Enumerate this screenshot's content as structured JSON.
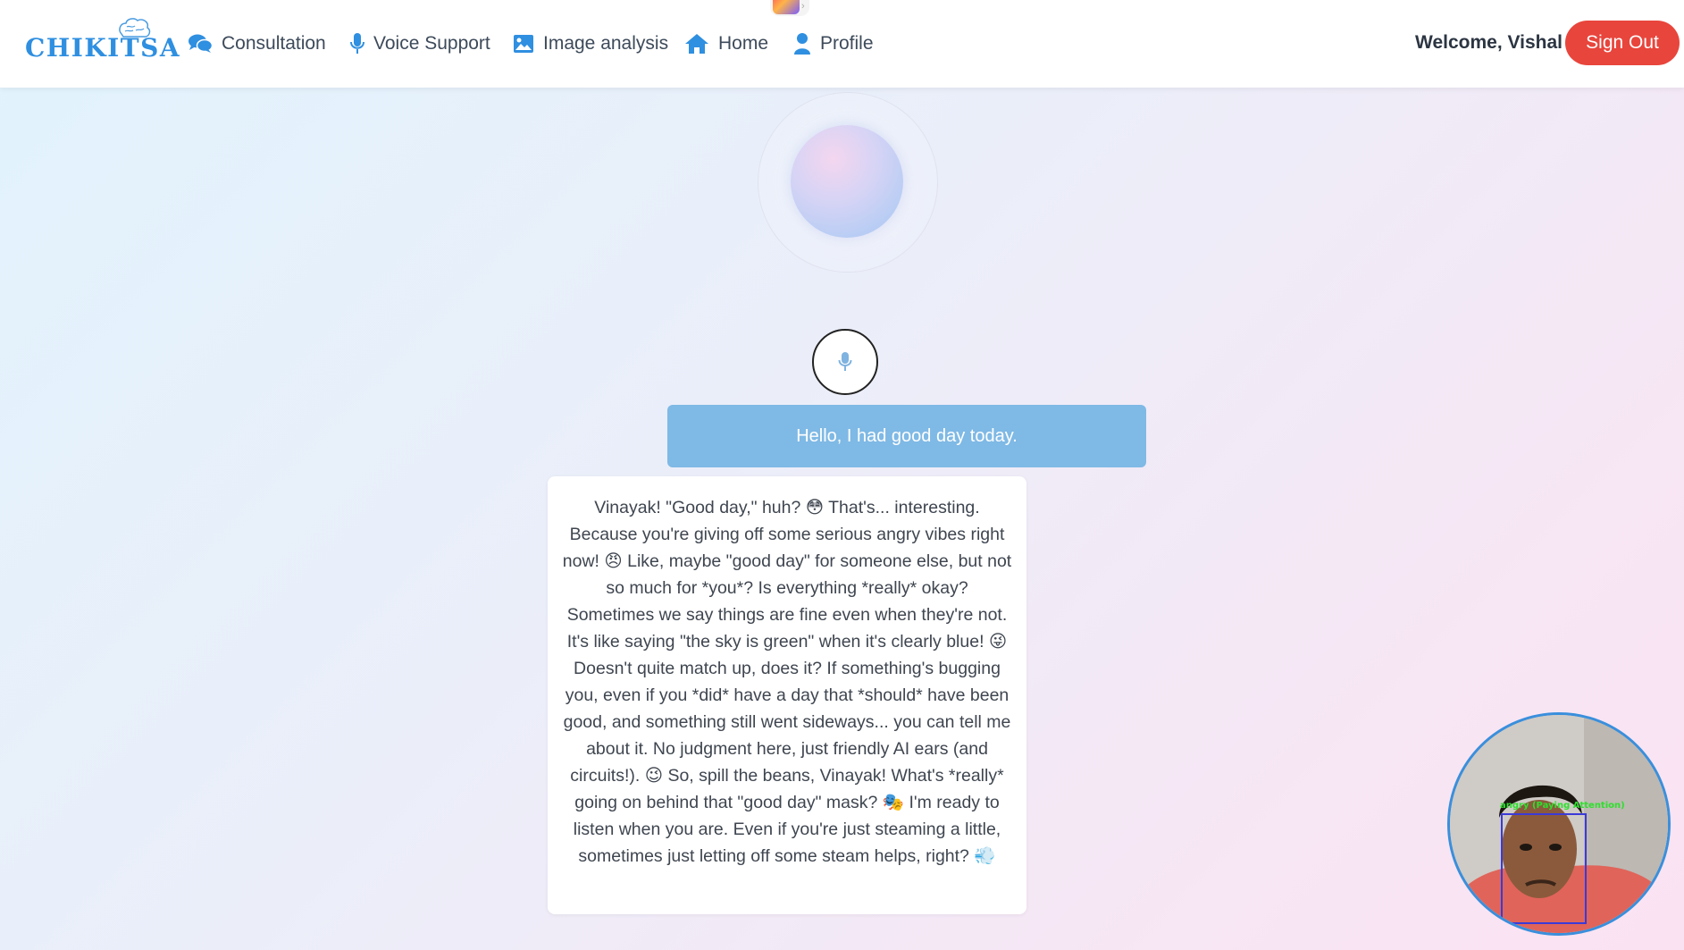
{
  "header": {
    "logo_text": "CHIKITSA",
    "nav": [
      {
        "label": "Consultation",
        "icon": "chat-icon"
      },
      {
        "label": "Voice Support",
        "icon": "microphone-icon"
      },
      {
        "label": "Image analysis",
        "icon": "image-icon"
      },
      {
        "label": "Home",
        "icon": "home-icon"
      },
      {
        "label": "Profile",
        "icon": "user-icon"
      }
    ],
    "welcome": "Welcome, Vishal",
    "signout_label": "Sign Out"
  },
  "chat": {
    "user_message": "Hello, I had good day today.",
    "bot_message": "Vinayak! \"Good day,\" huh? 😳 That's... interesting. Because you're giving off some serious angry vibes right now! 😠 Like, maybe \"good day\" for someone else, but not so much for *you*? Is everything *really* okay? Sometimes we say things are fine even when they're not. It's like saying \"the sky is green\" when it's clearly blue! 😜 Doesn't quite match up, does it? If something's bugging you, even if you *did* have a day that *should* have been good, and something still went sideways... you can tell me about it. No judgment here, just friendly AI ears (and circuits!). 😉 So, spill the beans, Vinayak! What's *really* going on behind that \"good day\" mask? 🎭 I'm ready to listen when you are. Even if you're just steaming a little, sometimes just letting off some steam helps, right? 💨"
  },
  "camera": {
    "emotion_label": "angry (Paying Attention)"
  },
  "colors": {
    "accent": "#2f8fe0",
    "signout": "#e8453c",
    "user_bubble": "#7fb9e5"
  }
}
